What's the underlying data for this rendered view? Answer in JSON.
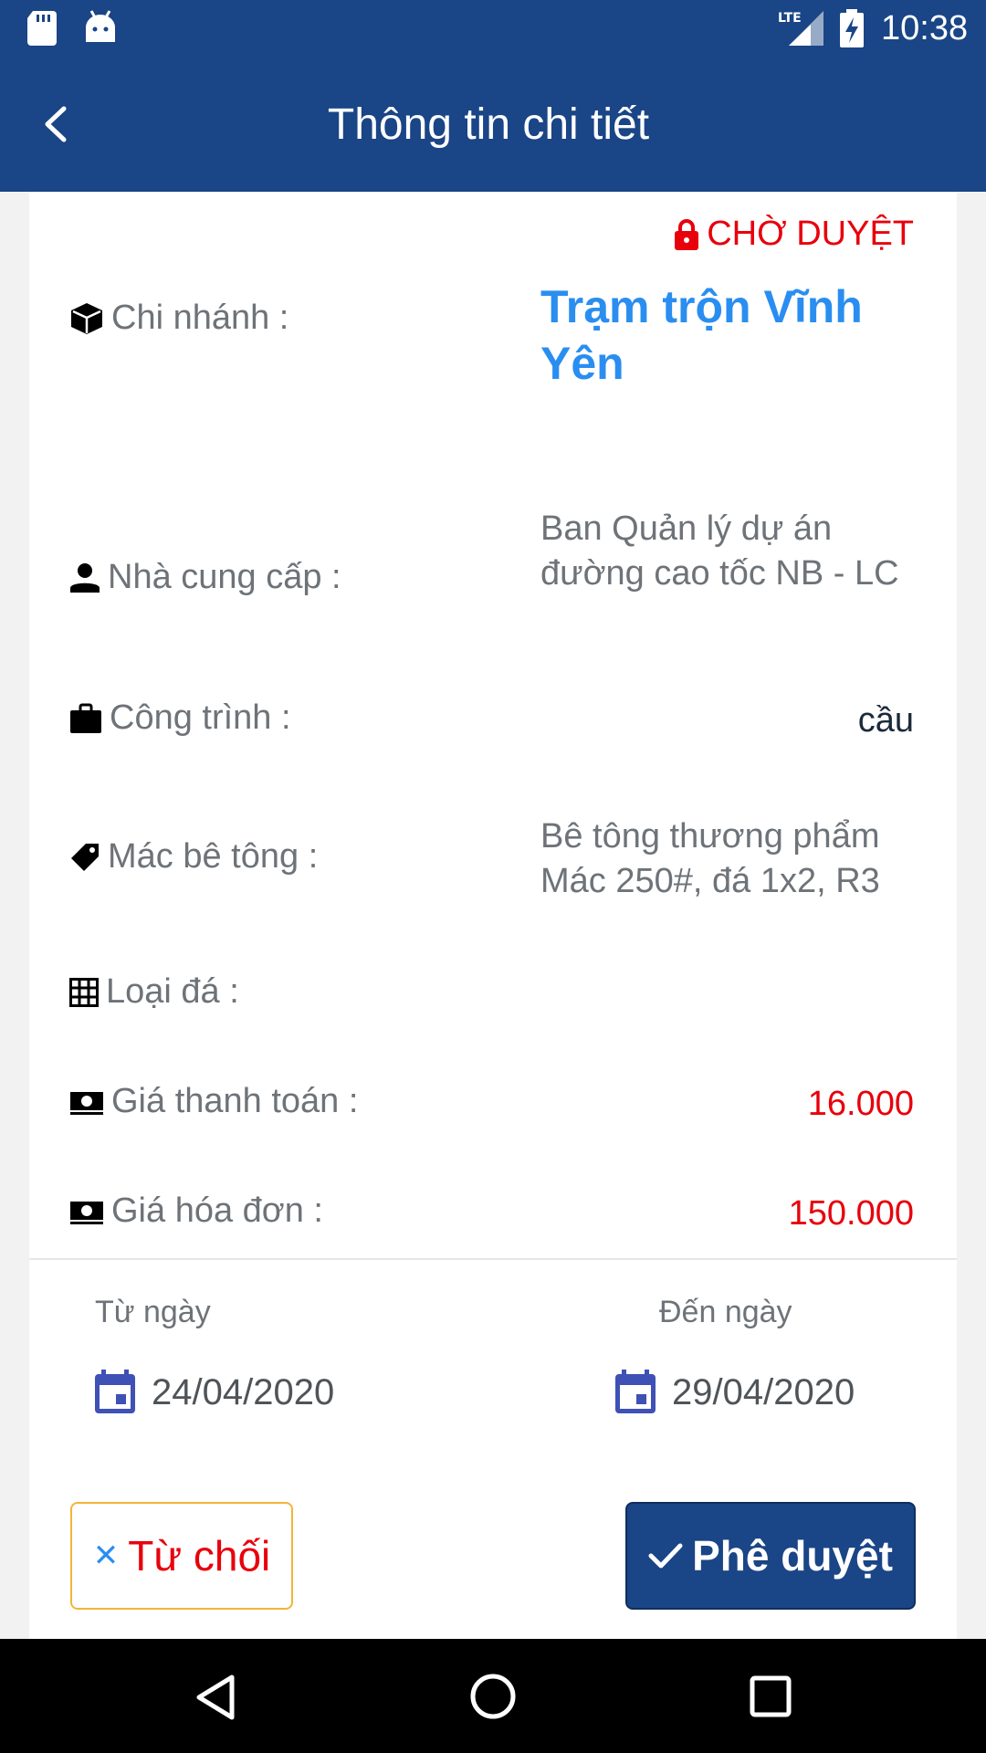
{
  "status_bar": {
    "time": "10:38",
    "network": "LTE",
    "icons": [
      "sd-card-icon",
      "android-debug-icon",
      "lte-signal-icon",
      "battery-charging-icon"
    ]
  },
  "app_bar": {
    "title": "Thông tin chi tiết",
    "back_icon": "chevron-left-icon"
  },
  "detail": {
    "status": "CHỜ DUYỆT",
    "status_color": "#e8000b",
    "fields": {
      "branch": {
        "label": "Chi nhánh :",
        "value": "Trạm trộn Vĩnh Yên",
        "icon": "cube-icon"
      },
      "supplier": {
        "label": "Nhà cung cấp :",
        "value": "Ban Quản lý dự án đường cao tốc NB - LC",
        "icon": "person-icon"
      },
      "project": {
        "label": "Công trình :",
        "value": "cầu",
        "icon": "briefcase-icon"
      },
      "concrete_grade": {
        "label": "Mác bê tông :",
        "value": "Bê tông thương phẩm Mác 250#, đá 1x2, R3",
        "icon": "tag-icon"
      },
      "stone_type": {
        "label": "Loại đá :",
        "value": "",
        "icon": "grid-icon"
      },
      "payment_price": {
        "label": "Giá thanh toán :",
        "value": "16.000",
        "icon": "money-icon"
      },
      "invoice_price": {
        "label": "Giá hóa đơn :",
        "value": "150.000",
        "icon": "money-icon"
      }
    },
    "dates": {
      "from_label": "Từ ngày",
      "from_value": "24/04/2020",
      "to_label": "Đến ngày",
      "to_value": "29/04/2020",
      "icon": "calendar-icon"
    }
  },
  "actions": {
    "reject_label": "Từ chối",
    "reject_icon": "close-icon",
    "approve_label": "Phê duyệt",
    "approve_icon": "check-icon"
  },
  "colors": {
    "primary": "#1a4586",
    "link_blue": "#2a8ef0",
    "accent_red": "#e8000b",
    "border_yellow": "#f2b53a"
  }
}
